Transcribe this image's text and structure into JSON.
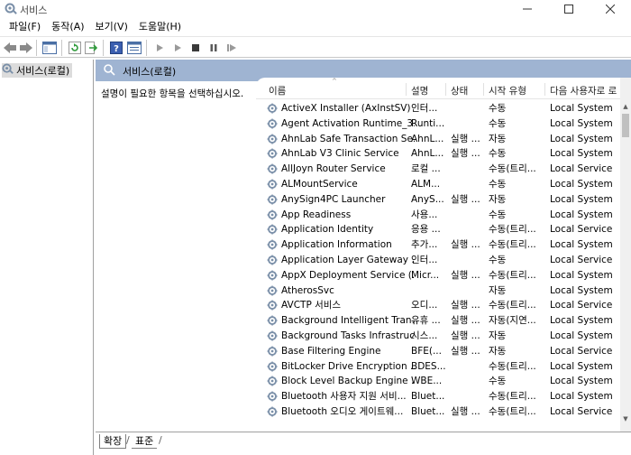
{
  "window": {
    "title": "서비스",
    "minimize": "—",
    "maximize": "☐",
    "close": "✕"
  },
  "menu": [
    "파일(F)",
    "동작(A)",
    "보기(V)",
    "도움말(H)"
  ],
  "tree": {
    "root_label": "서비스(로컬)"
  },
  "banner": {
    "title": "서비스(로컬)"
  },
  "description_prompt": "설명이 필요한 항목을 선택하십시오.",
  "list": {
    "columns": [
      "이름",
      "설명",
      "상태",
      "시작 유형",
      "다음 사용자로 로"
    ],
    "sort_indicator": "^",
    "rows": [
      {
        "name": "ActiveX Installer (AxInstSV)",
        "desc": "인터...",
        "state": "",
        "start": "수동",
        "logon": "Local System"
      },
      {
        "name": "Agent Activation Runtime_3...",
        "desc": "Runti...",
        "state": "",
        "start": "수동",
        "logon": "Local System"
      },
      {
        "name": "AhnLab Safe Transaction Se...",
        "desc": "AhnL...",
        "state": "실행 ...",
        "start": "자동",
        "logon": "Local System"
      },
      {
        "name": "AhnLab V3 Clinic Service",
        "desc": "AhnL...",
        "state": "실행 ...",
        "start": "수동",
        "logon": "Local System"
      },
      {
        "name": "AllJoyn Router Service",
        "desc": "로컬 ...",
        "state": "",
        "start": "수동(트리...",
        "logon": "Local Service"
      },
      {
        "name": "ALMountService",
        "desc": "ALM...",
        "state": "",
        "start": "수동",
        "logon": "Local System"
      },
      {
        "name": "AnySign4PC Launcher",
        "desc": "AnyS...",
        "state": "실행 ...",
        "start": "자동",
        "logon": "Local System"
      },
      {
        "name": "App Readiness",
        "desc": "사용...",
        "state": "",
        "start": "수동",
        "logon": "Local System"
      },
      {
        "name": "Application Identity",
        "desc": "응용 ...",
        "state": "",
        "start": "수동(트리...",
        "logon": "Local Service"
      },
      {
        "name": "Application Information",
        "desc": "추가...",
        "state": "실행 ...",
        "start": "수동(트리...",
        "logon": "Local System"
      },
      {
        "name": "Application Layer Gateway ...",
        "desc": "인터...",
        "state": "",
        "start": "수동",
        "logon": "Local Service"
      },
      {
        "name": "AppX Deployment Service (...",
        "desc": "Micr...",
        "state": "실행 ...",
        "start": "수동(트리...",
        "logon": "Local System"
      },
      {
        "name": "AtherosSvc",
        "desc": "",
        "state": "",
        "start": "자동",
        "logon": "Local System"
      },
      {
        "name": "AVCTP 서비스",
        "desc": "오디...",
        "state": "실행 ...",
        "start": "수동(트리...",
        "logon": "Local Service"
      },
      {
        "name": "Background Intelligent Tran...",
        "desc": "유휴 ...",
        "state": "실행 ...",
        "start": "자동(지연...",
        "logon": "Local System"
      },
      {
        "name": "Background Tasks Infrastruc...",
        "desc": "시스...",
        "state": "실행 ...",
        "start": "자동",
        "logon": "Local System"
      },
      {
        "name": "Base Filtering Engine",
        "desc": "BFE(...",
        "state": "실행 ...",
        "start": "자동",
        "logon": "Local Service"
      },
      {
        "name": "BitLocker Drive Encryption ...",
        "desc": "BDES...",
        "state": "",
        "start": "수동(트리...",
        "logon": "Local System"
      },
      {
        "name": "Block Level Backup Engine ...",
        "desc": "WBE...",
        "state": "",
        "start": "수동",
        "logon": "Local System"
      },
      {
        "name": "Bluetooth 사용자 지원 서비...",
        "desc": "Bluet...",
        "state": "",
        "start": "수동(트리...",
        "logon": "Local System"
      },
      {
        "name": "Bluetooth 오디오 게이트웨...",
        "desc": "Bluet...",
        "state": "실행 ...",
        "start": "수동(트리...",
        "logon": "Local Service"
      }
    ]
  },
  "tabs": {
    "extended": "확장",
    "standard": "표준"
  },
  "colors": {
    "banner": "#9fb4d2",
    "icon_gear": "#7a8fa8"
  }
}
